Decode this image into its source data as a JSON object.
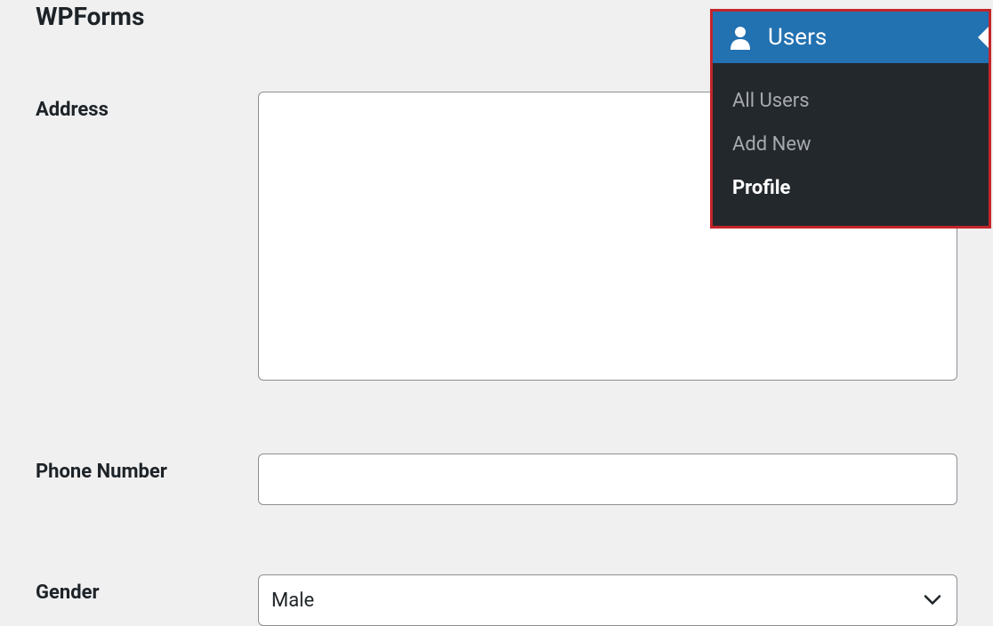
{
  "page": {
    "title": "WPForms"
  },
  "form": {
    "address": {
      "label": "Address",
      "value": ""
    },
    "phone": {
      "label": "Phone Number",
      "value": ""
    },
    "gender": {
      "label": "Gender",
      "value": "Male"
    }
  },
  "menu": {
    "header": "Users",
    "items": [
      {
        "label": "All Users",
        "active": false
      },
      {
        "label": "Add New",
        "active": false
      },
      {
        "label": "Profile",
        "active": true
      }
    ]
  }
}
